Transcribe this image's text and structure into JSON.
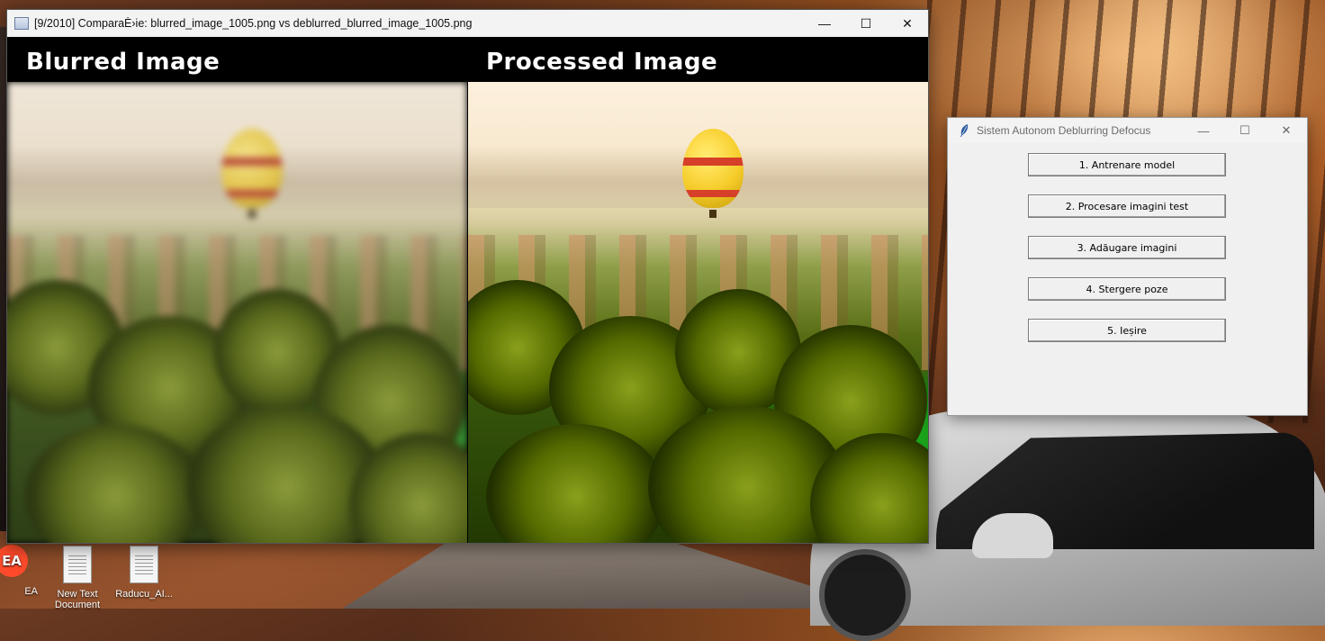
{
  "compare_window": {
    "title": "[9/2010] ComparaÈ›ie: blurred_image_1005.png vs deblurred_blurred_image_1005.png",
    "left_panel_label": "Blurred Image",
    "right_panel_label": "Processed Image",
    "controls": {
      "minimize": "—",
      "maximize": "☐",
      "close": "✕"
    }
  },
  "app_window": {
    "title": "Sistem Autonom Deblurring Defocus",
    "controls": {
      "minimize": "—",
      "maximize": "☐",
      "close": "✕"
    },
    "buttons": [
      "1. Antrenare model",
      "2. Procesare imagini test",
      "3. Adăugare imagini",
      "4. Stergere poze",
      "5. Ieșire"
    ]
  },
  "desktop": {
    "icons": [
      {
        "label": "EA",
        "icon": "ea-logo"
      },
      {
        "label": "New Text Document",
        "icon": "text-document-icon"
      },
      {
        "label": "Raducu_AI...",
        "icon": "text-document-icon"
      }
    ]
  }
}
